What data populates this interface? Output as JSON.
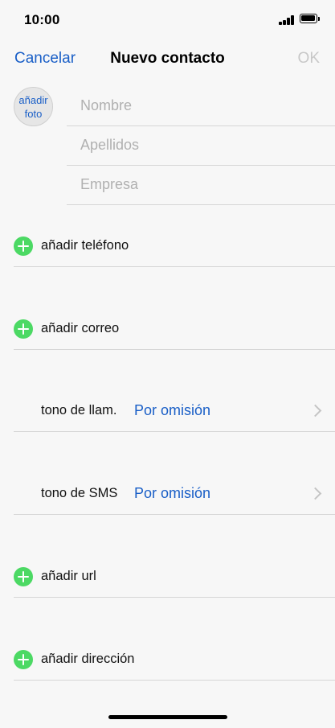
{
  "status_bar": {
    "time": "10:00",
    "signal_icon": "signal-bars-icon",
    "battery_icon": "battery-full-icon"
  },
  "nav": {
    "cancel_label": "Cancelar",
    "title": "Nuevo contacto",
    "ok_label": "OK"
  },
  "avatar": {
    "line1": "añadir",
    "line2": "foto"
  },
  "name_fields": {
    "first_placeholder": "Nombre",
    "last_placeholder": "Apellidos",
    "company_placeholder": "Empresa"
  },
  "rows": {
    "add_phone": "añadir teléfono",
    "add_email": "añadir correo",
    "ringtone": {
      "label": "tono de llam.",
      "value": "Por omisión"
    },
    "sms_tone": {
      "label": "tono de SMS",
      "value": "Por omisión"
    },
    "add_url": "añadir url",
    "add_address": "añadir dirección"
  },
  "colors": {
    "accent": "#1a5fc7",
    "add_green": "#4cd964",
    "disabled": "#c8c8c8",
    "background": "#f7f7f7"
  }
}
